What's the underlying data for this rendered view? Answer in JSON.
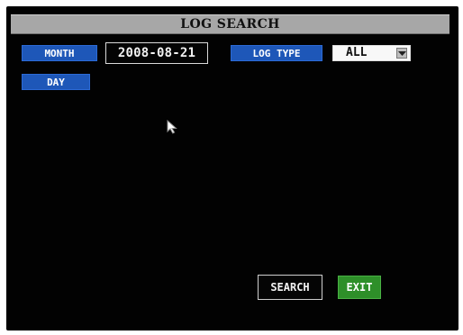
{
  "screen": {
    "title": "LOG SEARCH"
  },
  "form": {
    "month_label": "MONTH",
    "day_label": "DAY",
    "date_value": "2008-08-21",
    "log_type_label": "LOG TYPE",
    "log_type_value": "ALL"
  },
  "buttons": {
    "search": "SEARCH",
    "exit": "EXIT"
  },
  "icons": {
    "dropdown": "chevron-down-icon",
    "pointer": "mouse-pointer-icon"
  },
  "colors": {
    "background": "#020202",
    "title_bar": "#a7a7a7",
    "label_blue": "#1e57b8",
    "exit_green": "#2e8f29"
  }
}
